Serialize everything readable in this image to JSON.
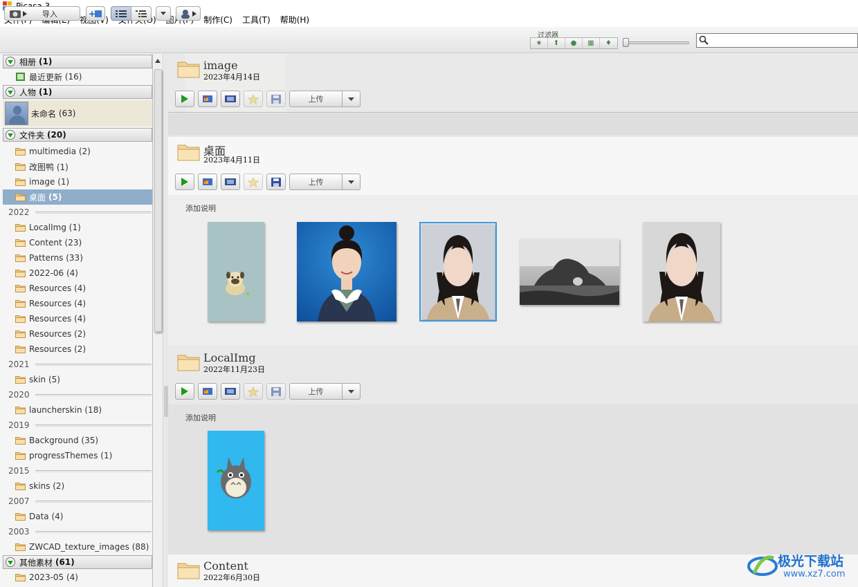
{
  "window": {
    "title": "Picasa 3"
  },
  "menu": [
    "文件(F)",
    "编辑(E)",
    "视图(V)",
    "文件夹(O)",
    "图片(P)",
    "制作(C)",
    "工具(T)",
    "帮助(H)"
  ],
  "toolbar": {
    "import_label": "导入",
    "filter_label": "过滤器",
    "search_placeholder": ""
  },
  "sidebar": {
    "albums": {
      "label": "相册",
      "count": "(1)"
    },
    "recent": {
      "label": "最近更新",
      "count": "(16)"
    },
    "people": {
      "label": "人物",
      "count": "(1)"
    },
    "unnamed": {
      "label": "未命名",
      "count": "(63)"
    },
    "folders": {
      "label": "文件夹",
      "count": "(20)"
    },
    "top_items": [
      "multimedia (2)",
      "改图鸭 (1)",
      "image (1)"
    ],
    "selected_item": {
      "name": "桌面",
      "count": "(5)"
    },
    "years": [
      {
        "year": "2022",
        "items": [
          "LocalImg (1)",
          "Content (23)",
          "Patterns (33)",
          "2022-06 (4)",
          "Resources (4)",
          "Resources (4)",
          "Resources (4)",
          "Resources (2)",
          "Resources (2)"
        ]
      },
      {
        "year": "2021",
        "items": [
          "skin (5)"
        ]
      },
      {
        "year": "2020",
        "items": [
          "launcherskin (18)"
        ]
      },
      {
        "year": "2019",
        "items": [
          "Background (35)",
          "progressThemes (1)"
        ]
      },
      {
        "year": "2015",
        "items": [
          "skins (2)"
        ]
      },
      {
        "year": "2007",
        "items": [
          "Data (4)"
        ]
      },
      {
        "year": "2003",
        "items": [
          "ZWCAD_texture_images (88)"
        ]
      }
    ],
    "other": {
      "label": "其他素材",
      "count": "(61)"
    },
    "other_items": [
      "2023-05 (4)"
    ]
  },
  "main": {
    "sections": [
      {
        "title": "image",
        "date": "2023年4月14日",
        "upload": "上传"
      },
      {
        "title": "桌面",
        "date": "2023年4月11日",
        "upload": "上传",
        "caption": "添加说明"
      },
      {
        "title": "LocalImg",
        "date": "2022年11月23日",
        "upload": "上传",
        "caption": "添加说明"
      },
      {
        "title": "Content",
        "date": "2022年6月30日"
      }
    ]
  },
  "watermark": {
    "name": "极光下载站",
    "url": "www.xz7.com"
  },
  "colors": {
    "selection": "#8eaec9",
    "thumb_outline": "#3b98e0",
    "play_green": "#1a9b1a"
  }
}
